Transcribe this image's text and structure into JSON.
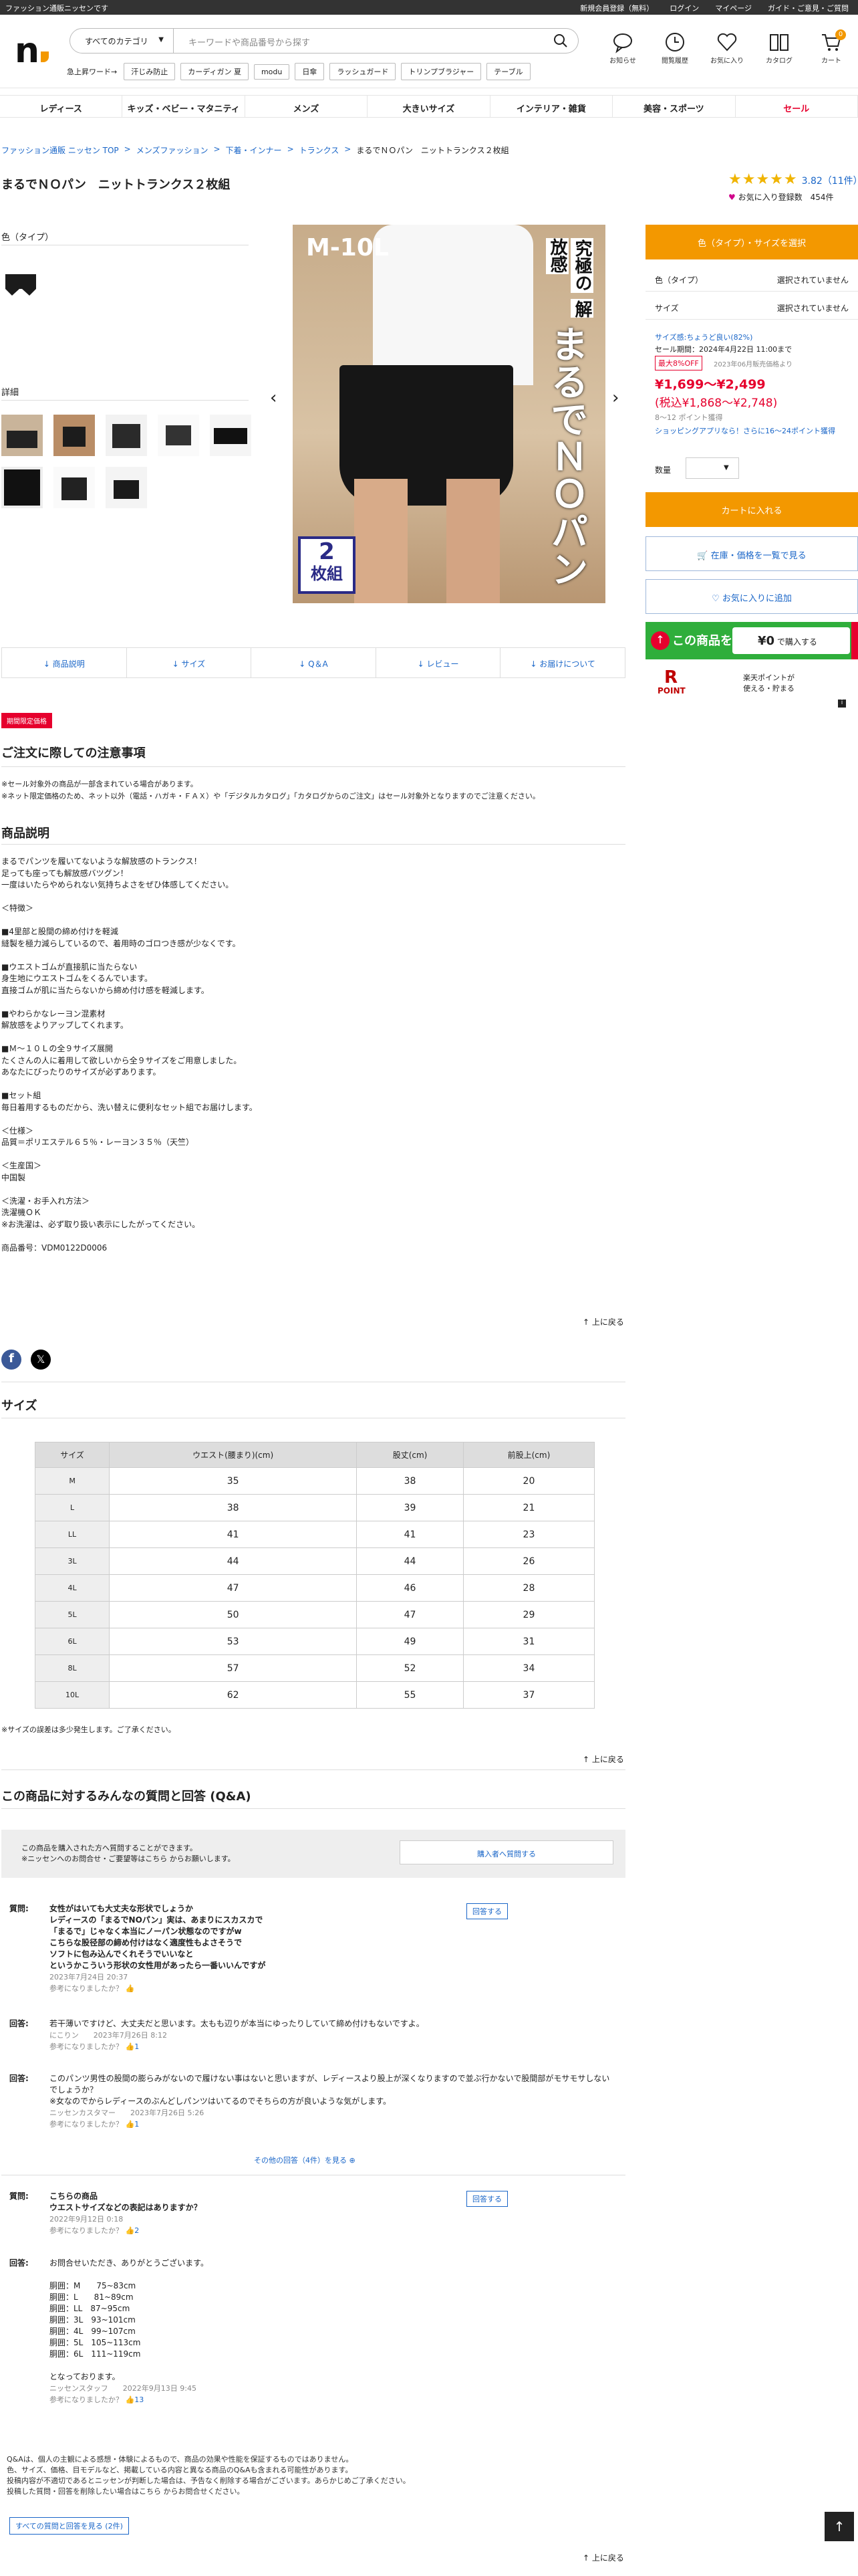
{
  "topbar": {
    "message": "ファッション通販ニッセンです",
    "links": [
      "新規会員登録（無料）",
      "ログイン",
      "マイページ",
      "ガイド・ご意見・ご質問"
    ]
  },
  "header": {
    "logo": "n",
    "category_select": "すべてのカテゴリ",
    "search_placeholder": "キーワードや商品番号から探す",
    "icons": [
      {
        "label": "お知らせ",
        "icon": "chat-icon"
      },
      {
        "label": "閲覧履歴",
        "icon": "clock-icon"
      },
      {
        "label": "お気に入り",
        "icon": "heart-icon"
      },
      {
        "label": "カタログ",
        "icon": "book-icon"
      },
      {
        "label": "カート",
        "icon": "cart-icon",
        "badge": "0"
      }
    ],
    "keyword_label": "急上昇ワード→",
    "keywords": [
      "汗じみ防止",
      "カーディガン 夏",
      "modu",
      "日傘",
      "ラッシュガード",
      "トリンプブラジャー",
      "テーブル"
    ]
  },
  "nav": [
    "レディース",
    "キッズ・ベビー・マタニティ",
    "メンズ",
    "大きいサイズ",
    "インテリア・雑貨",
    "美容・スポーツ",
    "セール"
  ],
  "breadcrumb": [
    "ファッション通販 ニッセン TOP",
    ">",
    "メンズファッション",
    ">",
    "下着・インナー",
    ">",
    "トランクス",
    ">",
    "まるでＮＯパン　ニットトランクス２枚組"
  ],
  "product": {
    "title": "まるでＮＯパン　ニットトランクス２枚組",
    "stars": "★★★★★",
    "rating": "3.82（11件）",
    "fav": "お気に入り登録数　454件",
    "color_label": "色（タイプ）",
    "detail_label": "詳細",
    "image_text": {
      "size": "M-10L",
      "catch1": "究極の",
      "catch2": "解放感",
      "main": "まるでＮＯパン",
      "pack1": "2",
      "pack2": "枚組"
    }
  },
  "purchase": {
    "select_btn": "色（タイプ）・サイズを選択",
    "opts": [
      {
        "l": "色（タイプ）",
        "r": "選択されていません"
      },
      {
        "l": "サイズ",
        "r": "選択されていません"
      }
    ],
    "fit": "サイズ感:ちょうど良い(82%)",
    "sale_period": "セール期間：2024年4月22日 11:00まで",
    "off_badge": "最大8%OFF",
    "orig": "2023年06月販売価格より",
    "price": "¥1,699〜¥2,499",
    "tax_price": "(税込¥1,868〜¥2,748)",
    "points": "8～12 ポイント獲得",
    "app_note": "ショッピングアプリなら！さらに16〜24ポイント獲得",
    "qty_label": "数量",
    "cart_btn": "カートに入れる",
    "stock_btn": "在庫・価格を一覧で見る",
    "fav_btn": "お気に入りに追加",
    "banner": {
      "text": "この商品を",
      "price": "¥0",
      "tail": "で購入する"
    },
    "rakuten": {
      "logo": "R",
      "label": "POINT",
      "text1": "楽天ポイントが",
      "text2": "使える・貯まる"
    }
  },
  "tabs": [
    "商品説明",
    "サイズ",
    "Q＆A",
    "レビュー",
    "お届けについて"
  ],
  "limited_badge": "期間限定価格",
  "notice": {
    "title": "ご注文に際しての注意事項",
    "lines": [
      "※セール対象外の商品が一部含まれている場合があります。",
      "※ネット限定価格のため、ネット以外（電話・ハガキ・ＦＡＸ）や「デジタルカタログ」「カタログからのご注文」はセール対象外となりますのでご注意ください。"
    ]
  },
  "desc": {
    "title": "商品説明",
    "body": "まるでパンツを履いてないような解放感のトランクス！\n足っても座っても解放感バツグン！\n一度はいたらやめられない気持ちよさをぜひ体感してください。\n\n＜特徴＞\n\n■4里部と股間の締め付けを軽減\n縫製を極力減らしているので、着用時のゴロつき感が少なくです。\n\n■ウエストゴムが直接肌に当たらない\n身生地にウエストゴムをくるんでいます。\n直接ゴムが肌に当たらないから締め付け感を軽減します。\n\n■やわらかなレーヨン混素材\n解放感をよりアップしてくれます。\n\n■Ｍ～１０Ｌの全９サイズ展開\nたくさんの人に着用して欲しいから全９サイズをご用意しました。\nあなたにぴったりのサイズが必ずあります。\n\n■セット組\n毎日着用するものだから、洗い替えに便利なセット組でお届けします。\n\n＜仕様＞\n品質＝ポリエステル６５％・レーヨン３５％（天竺）\n\n＜生産国＞\n中国製\n\n＜洗濯・お手入れ方法＞\n洗濯機ＯＫ\n※お洗濯は、必ず取り扱い表示にしたがってください。\n\n商品番号：VDM0122D0006",
    "totop": "上に戻る"
  },
  "size": {
    "title": "サイズ",
    "headers": [
      "サイズ",
      "ウエスト(腰まり)(cm)",
      "股丈(cm)",
      "前股上(cm)"
    ],
    "rows": [
      [
        "M",
        "35",
        "38",
        "20"
      ],
      [
        "L",
        "38",
        "39",
        "21"
      ],
      [
        "LL",
        "41",
        "41",
        "23"
      ],
      [
        "3L",
        "44",
        "44",
        "26"
      ],
      [
        "4L",
        "47",
        "46",
        "28"
      ],
      [
        "5L",
        "50",
        "47",
        "29"
      ],
      [
        "6L",
        "53",
        "49",
        "31"
      ],
      [
        "8L",
        "57",
        "52",
        "34"
      ],
      [
        "10L",
        "62",
        "55",
        "37"
      ]
    ],
    "note": "※サイズの誤差は多少発生します。ご了承ください。",
    "totop": "上に戻る"
  },
  "qa": {
    "title": "この商品に対するみんなの質問と回答 (Q&A)",
    "box1": "この商品を購入された方へ質問することができます。",
    "box2": "※ニッセンへのお問合せ・ご要望等はこちら からお願いします。",
    "box_btn": "購入者へ質問する",
    "q1": {
      "tag": "質問:",
      "text": "女性がはいても大丈夫な形状でしょうか\nレディースの「まるでNOパン」実は、あまりにスカスカで\n「まるで」じゃなく本当にノーパン状態なのですがw\nこちらな股径部の締め付けはなく適度性もよさそうで\nソフトに包み込んでくれそうでいいなと\nというかこういう形状の女性用があったら一番いいんですが",
      "date": "2023年7月24日 20:37",
      "helpful": "参考になりましたか？",
      "ans_btn": "回答する"
    },
    "a1": {
      "tag": "回答:",
      "text": "若干薄いですけど、大丈夫だと思います。太もも辺りが本当にゆったりしていて締め付けもないですよ。",
      "meta": "にこりン　　2023年7月26日 8:12",
      "helpful": "参考になりましたか？",
      "count": "1"
    },
    "a2": {
      "tag": "回答:",
      "text": "このパンツ男性の股間の膨らみがないので履けない事はないと思いますが、レディースより股上が深くなりますので並ぶ行かないで股間部がモサモサしないでしょうか？\n※女なのでからレディースのぶんどしパンツはいてるのでそちらの方が良いような気がします。",
      "meta": "ニッセンカスタマー　　2023年7月26日 5:26",
      "helpful": "参考になりましたか？",
      "count": "1"
    },
    "more": "その他の回答（4件）を見る",
    "q2": {
      "tag": "質問:",
      "text": "こちらの商品\nウエストサイズなどの表記はありますか？",
      "date": "2022年9月12日 0:18",
      "helpful": "参考になりましたか？",
      "count": "2",
      "ans_btn": "回答する"
    },
    "a3": {
      "tag": "回答:",
      "text": "お問合せいただき、ありがとうございます。\n\n胴囲：M　　75~83cm\n胴囲：L　　81~89cm\n胴囲：LL　87~95cm\n胴囲：3L　93~101cm\n胴囲：4L　99~107cm\n胴囲：5L　105~113cm\n胴囲：6L　111~119cm\n\nとなっております。",
      "meta": "ニッセンスタッフ　　2022年9月13日 9:45",
      "helpful": "参考になりましたか？",
      "count": "13"
    },
    "footnote": [
      "Q&Aは、個人の主観による感想・体験によるもので、商品の効果や性能を保証するものではありません。",
      "色、サイズ、価格、目モデルなど、掲載している内容と異なる商品のQ&Aも含まれる可能性があります。",
      "投稿内容が不適切であるとニッセンが判断した場合は、予告なく削除する場合がございます。あらかじめご了承ください。",
      "投稿した質問・回答を削除したい場合はこちら からお問合せください。"
    ],
    "all_btn": "すべての質問と回答を見る (2件)",
    "totop": "上に戻る"
  }
}
